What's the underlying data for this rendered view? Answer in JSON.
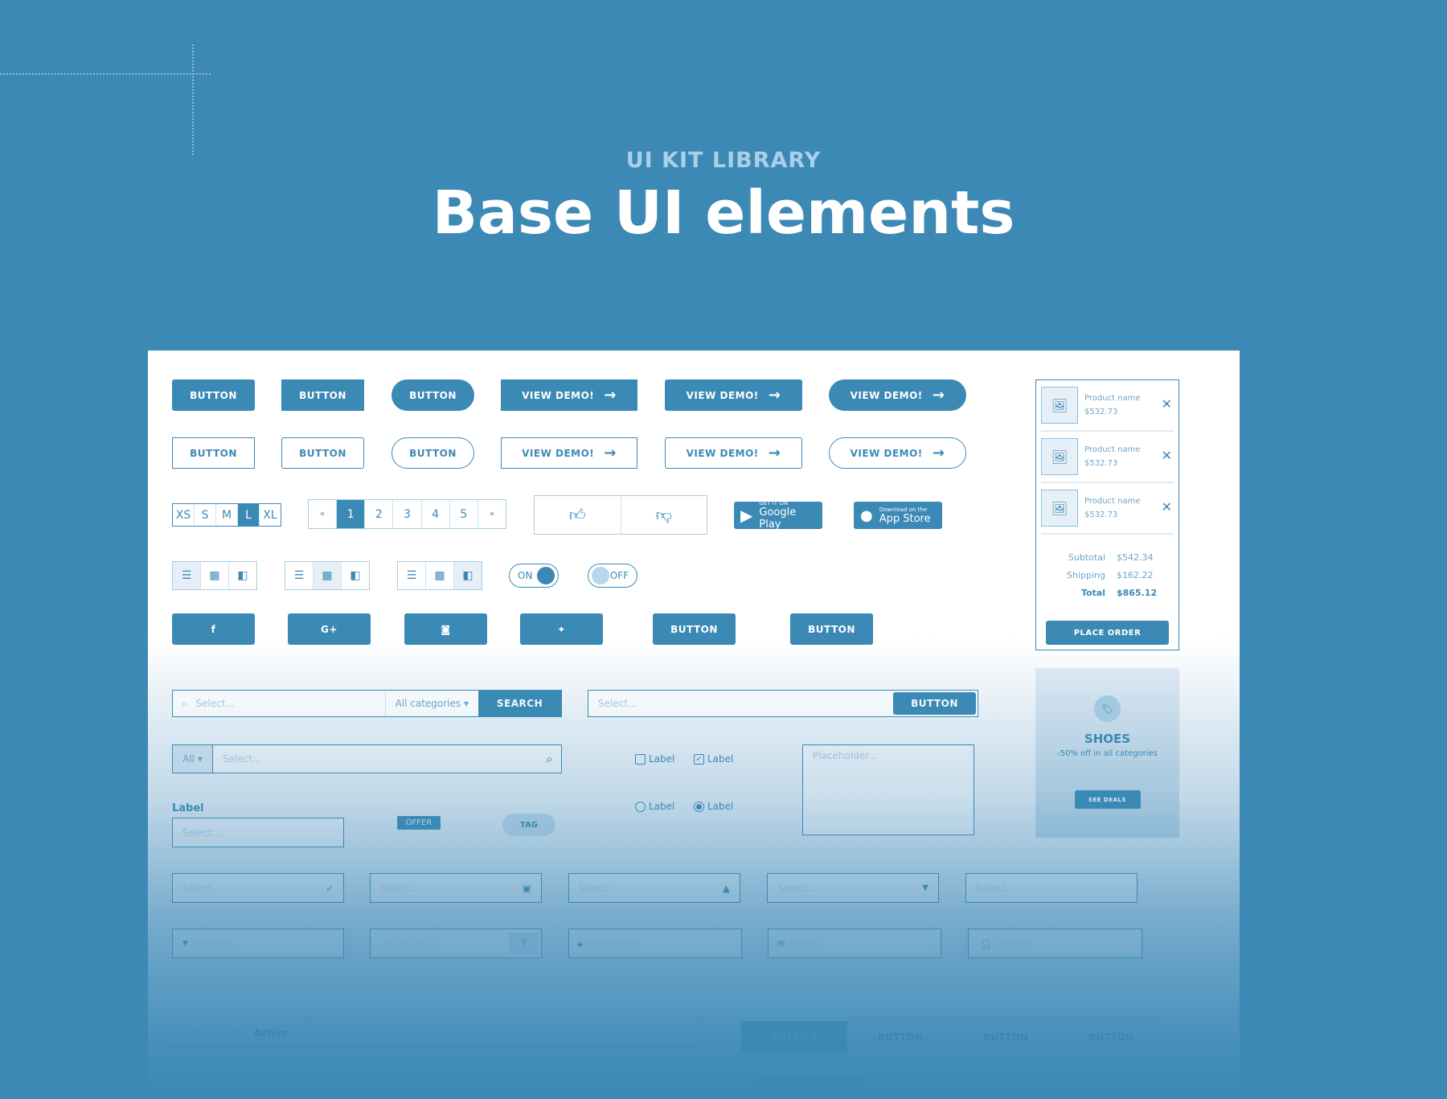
{
  "header": {
    "kicker": "UI KIT LIBRARY",
    "title": "Base UI elements"
  },
  "colors": {
    "background": "#3d89b6",
    "primary": "#3b89b5",
    "light": "#a8cde5"
  },
  "buttons": {
    "button": "BUTTON",
    "view_demo": "VIEW DEMO!",
    "arrow": "→"
  },
  "sizes": [
    "XS",
    "S",
    "M",
    "L",
    "XL"
  ],
  "size_selected": "L",
  "pagination": {
    "prev": "«",
    "pages": [
      "1",
      "2",
      "3",
      "4",
      "5"
    ],
    "next": "»",
    "current": "1"
  },
  "stores": {
    "google_small": "GET IT ON",
    "google_big": "Google Play",
    "apple_small": "Download on the",
    "apple_big": "App Store"
  },
  "toggles": {
    "on": "ON",
    "off": "OFF"
  },
  "social": [
    "facebook-icon",
    "google-plus-icon",
    "instagram-icon",
    "twitter-icon"
  ],
  "social_glyphs": [
    "f",
    "G+",
    "◙",
    "🐦"
  ],
  "search": {
    "placeholder": "Select...",
    "category": "All categories",
    "search_label": "SEARCH",
    "filter": "All"
  },
  "checks": {
    "label": "Label"
  },
  "textarea": {
    "placeholder": "Placeholder..."
  },
  "form": {
    "label": "Label",
    "offer": "OFFER",
    "tag": "TAG",
    "password": "Password",
    "email": "Email",
    "name": "Name",
    "card_mask": "····-····-····-····",
    "help": "?"
  },
  "cart": {
    "items": [
      {
        "name": "Product name",
        "price": "$532.73"
      },
      {
        "name": "Product name",
        "price": "$532.73"
      },
      {
        "name": "Product name",
        "price": "$532.73"
      }
    ],
    "subtotal_label": "Subtotal",
    "subtotal": "$542.34",
    "shipping_label": "Shipping",
    "shipping": "$162.22",
    "total_label": "Total",
    "total": "$865.12",
    "place_order": "PLACE ORDER"
  },
  "promo": {
    "title": "SHOES",
    "subtitle": "-50% off in all categories",
    "cta": "SEE DEALS"
  },
  "breadcrumb": [
    "Link",
    "Link",
    "Active"
  ],
  "breadcrumb_sep": "›"
}
